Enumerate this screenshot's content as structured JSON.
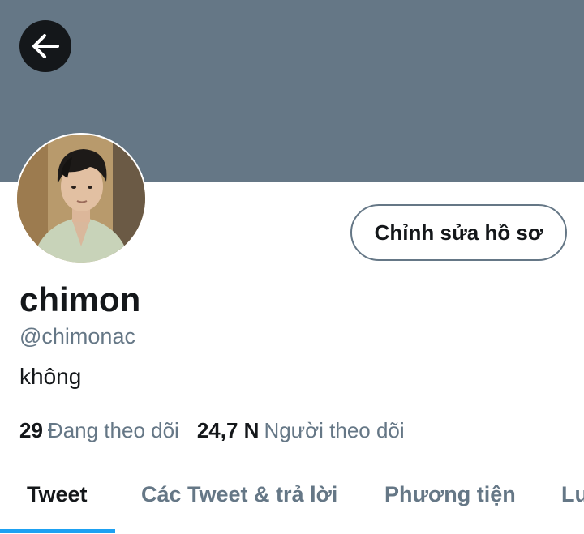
{
  "profile": {
    "display_name": "chimon",
    "handle": "@chimonac",
    "bio": "không",
    "edit_button_label": "Chỉnh sửa hồ sơ"
  },
  "stats": {
    "following_count": "29",
    "following_label": "Đang theo dõi",
    "followers_count": "24,7 N",
    "followers_label": "Người theo dõi"
  },
  "tabs": [
    {
      "label": "Tweet",
      "active": true
    },
    {
      "label": "Các Tweet & trả lời",
      "active": false
    },
    {
      "label": "Phương tiện",
      "active": false
    },
    {
      "label": "Lư",
      "active": false
    }
  ],
  "icons": {
    "back": "arrow-left-icon"
  },
  "colors": {
    "banner": "#657786",
    "accent": "#1da1f2",
    "text_primary": "#14171a",
    "text_secondary": "#657786"
  }
}
